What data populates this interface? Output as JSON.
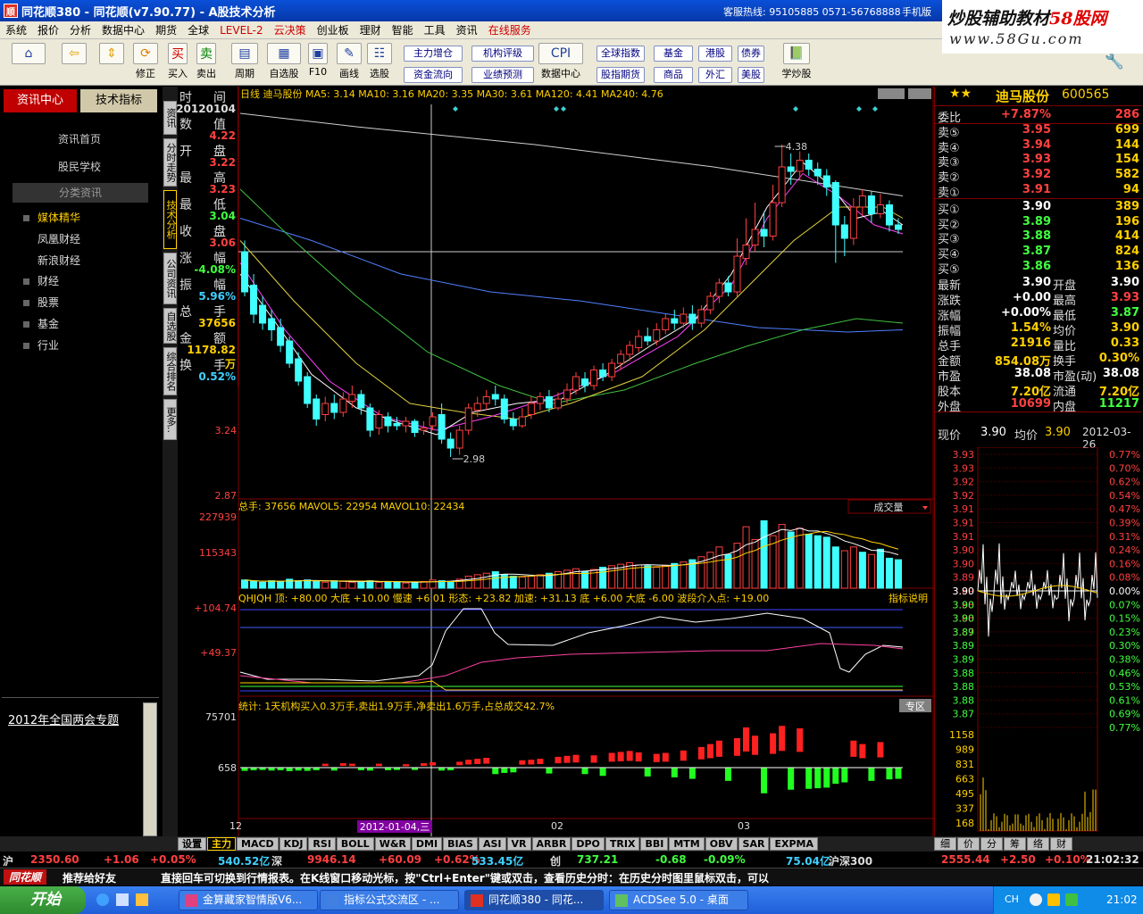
{
  "window": {
    "title": "同花顺380 - 同花顺(v7.90.77) - A股技术分析",
    "hotline": "客服热线: 95105885  0571-56768888",
    "phone": "手机版"
  },
  "watermark": {
    "line1_a": "炒股辅助教材",
    "line1_b": "58股网",
    "line2": "www.58Gu.com"
  },
  "menu": {
    "items": [
      "系统",
      "报价",
      "分析",
      "数据中心",
      "期货",
      "全球",
      "LEVEL-2",
      "云决策",
      "创业板",
      "理财",
      "智能",
      "工具",
      "资讯",
      "在线服务"
    ]
  },
  "toolbar": {
    "icons": [
      {
        "label": ""
      },
      {
        "label": ""
      },
      {
        "label": ""
      },
      {
        "label": "修正"
      },
      {
        "label": "买入"
      },
      {
        "label": "卖出"
      },
      {
        "label": "周期"
      },
      {
        "label": "自选股"
      },
      {
        "label": "F10"
      },
      {
        "label": "画线"
      },
      {
        "label": "选股"
      },
      {
        "label": "数据中心"
      },
      {
        "label": "学炒股"
      }
    ],
    "small_buttons": [
      "主力增仓",
      "机构评级",
      "全球指数",
      "基金",
      "港股",
      "债券",
      "资金流向",
      "业绩预测",
      "股指期货",
      "商品",
      "外汇",
      "美股"
    ]
  },
  "left": {
    "tab_active": "资讯中心",
    "tab_other": "技术指标",
    "links": [
      "资讯首页",
      "股民学校"
    ],
    "section": "分类资讯",
    "tree": [
      "媒体精华",
      "凤凰财经",
      "新浪财经",
      "财经",
      "股票",
      "基金",
      "行业"
    ],
    "special": "2012年全国两会专题"
  },
  "vtabs": [
    "资讯",
    "分时走势",
    "技术分析",
    "公司资讯",
    "自选股",
    "综合排名",
    "更多.."
  ],
  "infobox": {
    "labels": [
      "时",
      "间",
      "数",
      "值",
      "开",
      "盘",
      "最",
      "高",
      "最",
      "低",
      "收",
      "盘",
      "涨",
      "幅",
      "振",
      "幅",
      "总",
      "手",
      "金",
      "额",
      "换",
      "手"
    ],
    "values": [
      "20120104",
      "4.22",
      "3.22",
      "3.23",
      "3.04",
      "3.06",
      "-4.08%",
      "5.96%",
      "37656",
      "1178.82万",
      "0.52%"
    ]
  },
  "chart": {
    "header": "日线  迪马股份  MA5: 3.14  MA10: 3.16  MA20: 3.35  MA30: 3.61  MA120: 4.41  MA240: 4.76",
    "yticks_price": [
      "4.22",
      "3.24",
      "2.87"
    ],
    "high_mark": "4.38",
    "low_mark": "2.98",
    "vol_header": "总手: 37656  MAVOL5: 22954  MAVOL10: 22434",
    "vol_select": "成交量",
    "vol_ticks": [
      "227939",
      "115343"
    ],
    "ind_header": "QHJQH 顶: +80.00  大底 +10.00  慢速 +6.01  形态: +23.82  加速: +31.13  底 +6.00  大底 -6.00  波段介入点: +19.00",
    "ind_button": "指标说明",
    "ind_ticks": [
      "+104.74",
      "+49.37"
    ],
    "stat_header": "统计: 1天机构买入0.3万手,卖出1.9万手,净卖出1.6万手,占总成交42.7%",
    "stat_button": "专区",
    "stat_ticks": [
      "75701",
      "658"
    ],
    "x_labels": [
      "12",
      "2012-01-04,三",
      "02",
      "03"
    ]
  },
  "chart_data": {
    "type": "candlestick",
    "moving_averages": {
      "MA5": 3.14,
      "MA10": 3.16,
      "MA20": 3.35,
      "MA30": 3.61,
      "MA120": 4.41,
      "MA240": 4.76
    },
    "price_range": [
      2.87,
      4.22
    ],
    "high_label": 4.38,
    "low_label": 2.98,
    "candles": [
      {
        "o": 3.9,
        "c": 3.72,
        "h": 3.95,
        "l": 3.7
      },
      {
        "o": 3.75,
        "c": 3.62,
        "h": 3.8,
        "l": 3.58
      },
      {
        "o": 3.66,
        "c": 3.58,
        "h": 3.7,
        "l": 3.55
      },
      {
        "o": 3.6,
        "c": 3.55,
        "h": 3.64,
        "l": 3.5
      },
      {
        "o": 3.56,
        "c": 3.48,
        "h": 3.6,
        "l": 3.45
      },
      {
        "o": 3.5,
        "c": 3.4,
        "h": 3.52,
        "l": 3.38
      },
      {
        "o": 3.42,
        "c": 3.32,
        "h": 3.45,
        "l": 3.3
      },
      {
        "o": 3.34,
        "c": 3.22,
        "h": 3.36,
        "l": 3.2
      },
      {
        "o": 3.24,
        "c": 3.15,
        "h": 3.26,
        "l": 3.12
      },
      {
        "o": 3.17,
        "c": 3.22,
        "h": 3.25,
        "l": 3.14
      },
      {
        "o": 3.22,
        "c": 3.18,
        "h": 3.26,
        "l": 3.15
      },
      {
        "o": 3.18,
        "c": 3.24,
        "h": 3.27,
        "l": 3.16
      },
      {
        "o": 3.23,
        "c": 3.26,
        "h": 3.3,
        "l": 3.2
      },
      {
        "o": 3.26,
        "c": 3.2,
        "h": 3.28,
        "l": 3.17
      },
      {
        "o": 3.2,
        "c": 3.1,
        "h": 3.22,
        "l": 3.07
      },
      {
        "o": 3.11,
        "c": 3.17,
        "h": 3.19,
        "l": 3.08
      },
      {
        "o": 3.16,
        "c": 3.12,
        "h": 3.18,
        "l": 3.09
      },
      {
        "o": 3.13,
        "c": 3.12,
        "h": 3.16,
        "l": 3.1
      },
      {
        "o": 3.12,
        "c": 3.14,
        "h": 3.16,
        "l": 3.09
      },
      {
        "o": 3.14,
        "c": 3.09,
        "h": 3.15,
        "l": 3.07
      },
      {
        "o": 3.1,
        "c": 3.11,
        "h": 3.14,
        "l": 3.08
      },
      {
        "o": 3.12,
        "c": 3.16,
        "h": 3.18,
        "l": 3.1
      },
      {
        "o": 3.17,
        "c": 3.06,
        "h": 3.22,
        "l": 3.04
      },
      {
        "o": 3.06,
        "c": 3.02,
        "h": 3.09,
        "l": 2.98
      },
      {
        "o": 3.02,
        "c": 3.1,
        "h": 3.12,
        "l": 2.99
      },
      {
        "o": 3.1,
        "c": 3.2,
        "h": 3.22,
        "l": 3.08
      },
      {
        "o": 3.19,
        "c": 3.22,
        "h": 3.25,
        "l": 3.16
      },
      {
        "o": 3.22,
        "c": 3.25,
        "h": 3.28,
        "l": 3.19
      },
      {
        "o": 3.26,
        "c": 3.24,
        "h": 3.3,
        "l": 3.21
      },
      {
        "o": 3.24,
        "c": 3.15,
        "h": 3.26,
        "l": 3.13
      },
      {
        "o": 3.15,
        "c": 3.12,
        "h": 3.18,
        "l": 3.1
      },
      {
        "o": 3.12,
        "c": 3.16,
        "h": 3.2,
        "l": 3.11
      },
      {
        "o": 3.17,
        "c": 3.22,
        "h": 3.25,
        "l": 3.15
      },
      {
        "o": 3.22,
        "c": 3.25,
        "h": 3.27,
        "l": 3.19
      },
      {
        "o": 3.25,
        "c": 3.2,
        "h": 3.28,
        "l": 3.18
      },
      {
        "o": 3.2,
        "c": 3.24,
        "h": 3.27,
        "l": 3.19
      },
      {
        "o": 3.24,
        "c": 3.28,
        "h": 3.31,
        "l": 3.22
      },
      {
        "o": 3.28,
        "c": 3.34,
        "h": 3.36,
        "l": 3.26
      },
      {
        "o": 3.33,
        "c": 3.3,
        "h": 3.36,
        "l": 3.27
      },
      {
        "o": 3.3,
        "c": 3.37,
        "h": 3.39,
        "l": 3.28
      },
      {
        "o": 3.37,
        "c": 3.34,
        "h": 3.4,
        "l": 3.32
      },
      {
        "o": 3.34,
        "c": 3.4,
        "h": 3.42,
        "l": 3.32
      },
      {
        "o": 3.4,
        "c": 3.44,
        "h": 3.46,
        "l": 3.37
      },
      {
        "o": 3.44,
        "c": 3.48,
        "h": 3.5,
        "l": 3.41
      },
      {
        "o": 3.47,
        "c": 3.52,
        "h": 3.55,
        "l": 3.45
      },
      {
        "o": 3.52,
        "c": 3.5,
        "h": 3.56,
        "l": 3.48
      },
      {
        "o": 3.5,
        "c": 3.55,
        "h": 3.58,
        "l": 3.48
      },
      {
        "o": 3.55,
        "c": 3.6,
        "h": 3.62,
        "l": 3.53
      },
      {
        "o": 3.6,
        "c": 3.58,
        "h": 3.64,
        "l": 3.55
      },
      {
        "o": 3.58,
        "c": 3.62,
        "h": 3.65,
        "l": 3.56
      },
      {
        "o": 3.62,
        "c": 3.58,
        "h": 3.66,
        "l": 3.55
      },
      {
        "o": 3.58,
        "c": 3.64,
        "h": 3.66,
        "l": 3.56
      },
      {
        "o": 3.64,
        "c": 3.7,
        "h": 3.72,
        "l": 3.62
      },
      {
        "o": 3.7,
        "c": 3.76,
        "h": 3.78,
        "l": 3.67
      },
      {
        "o": 3.76,
        "c": 3.72,
        "h": 3.79,
        "l": 3.7
      },
      {
        "o": 3.72,
        "c": 3.88,
        "h": 3.96,
        "l": 3.7
      },
      {
        "o": 3.87,
        "c": 3.93,
        "h": 4.05,
        "l": 3.84
      },
      {
        "o": 3.93,
        "c": 4.0,
        "h": 4.12,
        "l": 3.9
      },
      {
        "o": 4.0,
        "c": 3.97,
        "h": 4.08,
        "l": 3.92
      },
      {
        "o": 3.97,
        "c": 4.12,
        "h": 4.2,
        "l": 3.95
      },
      {
        "o": 4.12,
        "c": 4.28,
        "h": 4.38,
        "l": 4.1
      },
      {
        "o": 4.28,
        "c": 4.26,
        "h": 4.34,
        "l": 4.2
      },
      {
        "o": 4.26,
        "c": 4.31,
        "h": 4.35,
        "l": 4.22
      },
      {
        "o": 4.31,
        "c": 4.27,
        "h": 4.34,
        "l": 4.24
      },
      {
        "o": 4.27,
        "c": 4.24,
        "h": 4.3,
        "l": 4.2
      },
      {
        "o": 4.24,
        "c": 4.19,
        "h": 4.27,
        "l": 4.15
      },
      {
        "o": 4.21,
        "c": 4.02,
        "h": 4.22,
        "l": 3.85
      },
      {
        "o": 4.02,
        "c": 3.96,
        "h": 4.06,
        "l": 3.88
      },
      {
        "o": 3.96,
        "c": 4.1,
        "h": 4.14,
        "l": 3.93
      },
      {
        "o": 4.1,
        "c": 4.15,
        "h": 4.18,
        "l": 4.06
      },
      {
        "o": 4.15,
        "c": 4.07,
        "h": 4.17,
        "l": 4.03
      },
      {
        "o": 4.07,
        "c": 4.11,
        "h": 4.16,
        "l": 4.05
      },
      {
        "o": 4.11,
        "c": 4.02,
        "h": 4.13,
        "l": 3.99
      },
      {
        "o": 4.02,
        "c": 4.0,
        "h": 4.05,
        "l": 3.98
      }
    ],
    "volume_range": [
      0,
      227939
    ],
    "volume": [
      11,
      9,
      8,
      10,
      9,
      12,
      10,
      11,
      9,
      8,
      10,
      9,
      8,
      9,
      10,
      8,
      9,
      8,
      7,
      8,
      9,
      11,
      10,
      9,
      12,
      16,
      18,
      20,
      22,
      18,
      16,
      15,
      16,
      18,
      20,
      22,
      24,
      26,
      22,
      25,
      28,
      30,
      32,
      34,
      31,
      30,
      28,
      30,
      33,
      35,
      38,
      42,
      48,
      55,
      45,
      60,
      82,
      65,
      90,
      70,
      85,
      75,
      80,
      72,
      70,
      68,
      55,
      50,
      55,
      48,
      45,
      52,
      40,
      38
    ],
    "volume_up": [
      false,
      false,
      false,
      false,
      false,
      false,
      false,
      false,
      false,
      true,
      false,
      true,
      true,
      false,
      false,
      true,
      false,
      false,
      true,
      false,
      true,
      true,
      false,
      false,
      true,
      true,
      true,
      true,
      false,
      false,
      false,
      true,
      true,
      true,
      false,
      true,
      true,
      true,
      false,
      true,
      false,
      true,
      true,
      true,
      true,
      false,
      true,
      true,
      false,
      true,
      false,
      true,
      true,
      true,
      false,
      true,
      true,
      true,
      false,
      true,
      true,
      false,
      true,
      false,
      false,
      false,
      false,
      true,
      true,
      false,
      true,
      false,
      false,
      false
    ]
  },
  "quote": {
    "name": "迪马股份",
    "code": "600565",
    "rows": [
      {
        "lab": "委比",
        "pr": "+7.87%",
        "vol": "286",
        "pc": "#ff4040"
      },
      {
        "lab": "卖⑤",
        "pr": "3.95",
        "vol": "699",
        "pc": "#ff4040"
      },
      {
        "lab": "卖④",
        "pr": "3.94",
        "vol": "144",
        "pc": "#ff4040"
      },
      {
        "lab": "卖③",
        "pr": "3.93",
        "vol": "154",
        "pc": "#ff4040"
      },
      {
        "lab": "卖②",
        "pr": "3.92",
        "vol": "582",
        "pc": "#ff4040"
      },
      {
        "lab": "卖①",
        "pr": "3.91",
        "vol": "94",
        "pc": "#ff4040"
      },
      {
        "lab": "买①",
        "pr": "3.90",
        "vol": "389",
        "pc": "#ffffff"
      },
      {
        "lab": "买②",
        "pr": "3.89",
        "vol": "196",
        "pc": "#40ff40"
      },
      {
        "lab": "买③",
        "pr": "3.88",
        "vol": "414",
        "pc": "#40ff40"
      },
      {
        "lab": "买④",
        "pr": "3.87",
        "vol": "824",
        "pc": "#40ff40"
      },
      {
        "lab": "买⑤",
        "pr": "3.86",
        "vol": "136",
        "pc": "#40ff40"
      }
    ],
    "stats": [
      {
        "l1": "最新",
        "v1": "3.90",
        "c1": "#ffffff",
        "l2": "开盘",
        "v2": "3.90",
        "c2": "#ffffff"
      },
      {
        "l1": "涨跌",
        "v1": "+0.00",
        "c1": "#ffffff",
        "l2": "最高",
        "v2": "3.93",
        "c2": "#ff4040"
      },
      {
        "l1": "涨幅",
        "v1": "+0.00%",
        "c1": "#ffffff",
        "l2": "最低",
        "v2": "3.87",
        "c2": "#40ff40"
      },
      {
        "l1": "振幅",
        "v1": "1.54%",
        "c1": "#ffd000",
        "l2": "均价",
        "v2": "3.90",
        "c2": "#ffd000"
      },
      {
        "l1": "总手",
        "v1": "21916",
        "c1": "#ffd000",
        "l2": "量比",
        "v2": "0.33",
        "c2": "#ffd000"
      },
      {
        "l1": "金额",
        "v1": "854.08万",
        "c1": "#ffd000",
        "l2": "换手",
        "v2": "0.30%",
        "c2": "#ffd000"
      },
      {
        "l1": "市盈",
        "v1": "38.08",
        "c1": "#ffffff",
        "l2": "市盈(动)",
        "v2": "38.08",
        "c2": "#ffffff"
      },
      {
        "l1": "股本",
        "v1": "7.20亿",
        "c1": "#ffd000",
        "l2": "流通",
        "v2": "7.20亿",
        "c2": "#ffd000"
      },
      {
        "l1": "外盘",
        "v1": "10699",
        "c1": "#ff4040",
        "l2": "内盘",
        "v2": "11217",
        "c2": "#40ff40"
      }
    ],
    "mini_header": {
      "a": "现价",
      "b": "3.90",
      "c": "均价",
      "d": "3.90",
      "date": "2012-03-26"
    },
    "mini_prices": [
      "3.93",
      "3.93",
      "3.92",
      "3.92",
      "3.91",
      "3.91",
      "3.91",
      "3.90",
      "3.90",
      "3.89",
      "3.89",
      "3.88",
      "3.88",
      "3.87"
    ],
    "mini_pcts": [
      "0.77%",
      "0.70%",
      "0.62%",
      "0.54%",
      "0.47%",
      "0.39%",
      "0.31%",
      "0.24%",
      "0.16%",
      "0.08%",
      "0.00%",
      "0.07%",
      "0.15%",
      "0.23%",
      "0.30%",
      "0.38%",
      "0.46%",
      "0.53%",
      "0.61%",
      "0.69%",
      "0.77%"
    ],
    "mini_prices2": [
      "3.90",
      "3.90",
      "3.90",
      "3.89",
      "3.89",
      "3.89",
      "3.88",
      "3.88",
      "3.88",
      "3.87"
    ],
    "mini_vols": [
      "1158",
      "989",
      "831",
      "663",
      "495",
      "337",
      "168"
    ],
    "tabs": [
      "细",
      "价",
      "分",
      "筹",
      "络",
      "财"
    ]
  },
  "bottom_tabs": [
    "设置",
    "主力",
    "MACD",
    "KDJ",
    "RSI",
    "BOLL",
    "W&R",
    "DMI",
    "BIAS",
    "ASI",
    "VR",
    "ARBR",
    "DPO",
    "TRIX",
    "BBI",
    "MTM",
    "OBV",
    "SAR",
    "EXPMA"
  ],
  "ticker": [
    {
      "t": "沪",
      "c": "#ddd"
    },
    {
      "t": "2350.60",
      "c": "#ff4040"
    },
    {
      "t": "+1.06",
      "c": "#ff4040"
    },
    {
      "t": "+0.05%",
      "c": "#ff4040"
    },
    {
      "t": "540.52亿",
      "c": "#40d0ff"
    },
    {
      "t": "深",
      "c": "#ddd"
    },
    {
      "t": "9946.14",
      "c": "#ff4040"
    },
    {
      "t": "+60.09",
      "c": "#ff4040"
    },
    {
      "t": "+0.62%",
      "c": "#ff4040"
    },
    {
      "t": "533.45亿",
      "c": "#40d0ff"
    },
    {
      "t": "创",
      "c": "#ddd"
    },
    {
      "t": "737.21",
      "c": "#40ff40"
    },
    {
      "t": "-0.68",
      "c": "#40ff40"
    },
    {
      "t": "-0.09%",
      "c": "#40ff40"
    },
    {
      "t": "75.04亿",
      "c": "#40d0ff"
    },
    {
      "t": "沪深300",
      "c": "#ddd"
    },
    {
      "t": "2555.44",
      "c": "#ff4040"
    },
    {
      "t": "+2.50",
      "c": "#ff4040"
    },
    {
      "t": "+0.10%",
      "c": "#ff4040"
    },
    {
      "t": "21:02:32",
      "c": "#ddd"
    }
  ],
  "news": {
    "logo": "同花顺",
    "recommend": "推荐给好友",
    "text": "直接回车可切换到行情报表。在K线窗口移动光标，按\"Ctrl+Enter\"键或双击，查看历史分时：在历史分时图里鼠标双击，可以"
  },
  "taskbar": {
    "start": "开始",
    "tasks": [
      "金算藏家智情版V6...",
      "指标公式交流区 - ...",
      "同花顺380 - 同花...",
      "ACDSee 5.0 - 桌面"
    ],
    "lang": "CH",
    "time": "21:02"
  }
}
